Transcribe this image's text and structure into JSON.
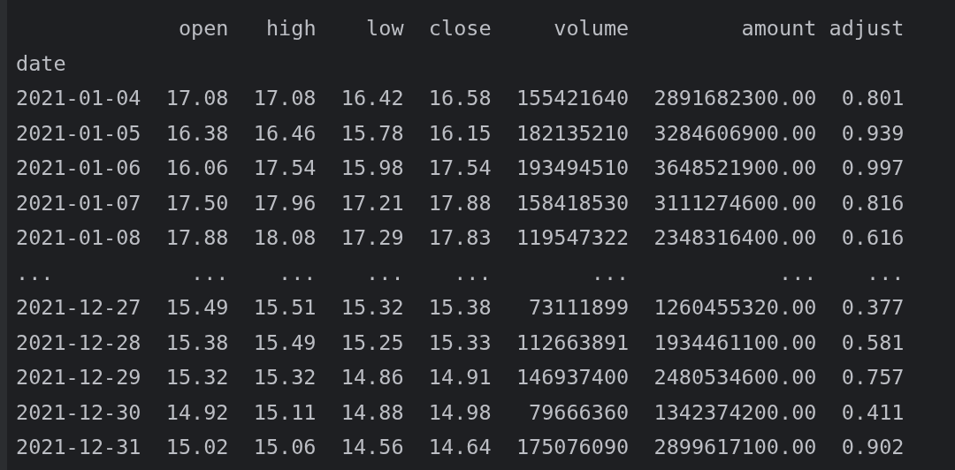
{
  "output": {
    "columns": [
      "open",
      "high",
      "low",
      "close",
      "volume",
      "amount",
      "adjust"
    ],
    "index_name": "date",
    "rows": [
      {
        "index": "2021-01-04",
        "values": [
          "17.08",
          "17.08",
          "16.42",
          "16.58",
          "155421640",
          "2891682300.00",
          "0.801"
        ]
      },
      {
        "index": "2021-01-05",
        "values": [
          "16.38",
          "16.46",
          "15.78",
          "16.15",
          "182135210",
          "3284606900.00",
          "0.939"
        ]
      },
      {
        "index": "2021-01-06",
        "values": [
          "16.06",
          "17.54",
          "15.98",
          "17.54",
          "193494510",
          "3648521900.00",
          "0.997"
        ]
      },
      {
        "index": "2021-01-07",
        "values": [
          "17.50",
          "17.96",
          "17.21",
          "17.88",
          "158418530",
          "3111274600.00",
          "0.816"
        ]
      },
      {
        "index": "2021-01-08",
        "values": [
          "17.88",
          "18.08",
          "17.29",
          "17.83",
          "119547322",
          "2348316400.00",
          "0.616"
        ]
      },
      {
        "index": "...",
        "values": [
          "...",
          "...",
          "...",
          "...",
          "...",
          "...",
          "..."
        ]
      },
      {
        "index": "2021-12-27",
        "values": [
          "15.49",
          "15.51",
          "15.32",
          "15.38",
          "73111899",
          "1260455320.00",
          "0.377"
        ]
      },
      {
        "index": "2021-12-28",
        "values": [
          "15.38",
          "15.49",
          "15.25",
          "15.33",
          "112663891",
          "1934461100.00",
          "0.581"
        ]
      },
      {
        "index": "2021-12-29",
        "values": [
          "15.32",
          "15.32",
          "14.86",
          "14.91",
          "146937400",
          "2480534600.00",
          "0.757"
        ]
      },
      {
        "index": "2021-12-30",
        "values": [
          "14.92",
          "15.11",
          "14.88",
          "14.98",
          "79666360",
          "1342374200.00",
          "0.411"
        ]
      },
      {
        "index": "2021-12-31",
        "values": [
          "15.02",
          "15.06",
          "14.56",
          "14.64",
          "175076090",
          "2899617100.00",
          "0.902"
        ]
      }
    ]
  }
}
